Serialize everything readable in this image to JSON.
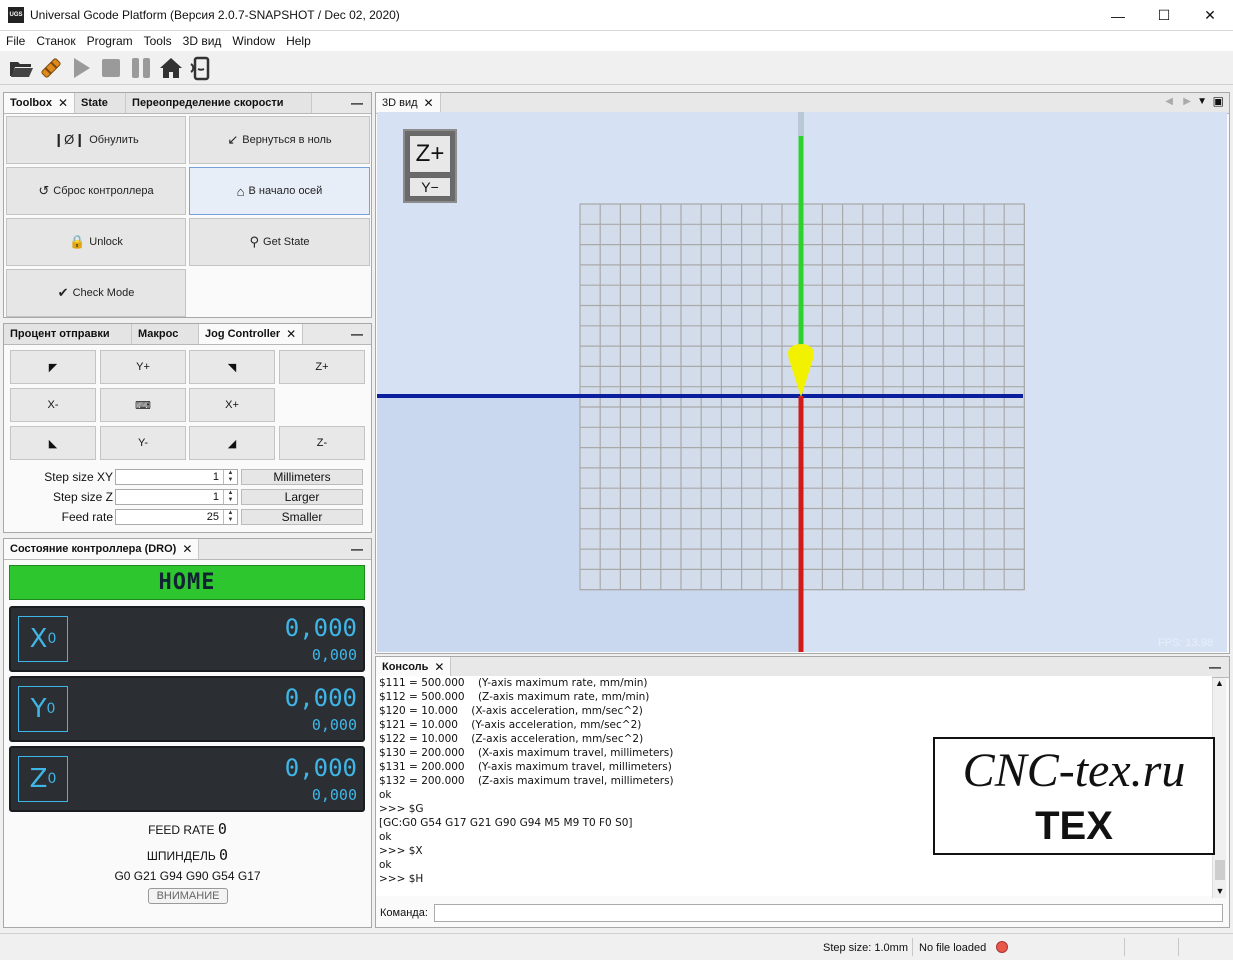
{
  "window": {
    "title": "Universal Gcode Platform (Версия 2.0.7-SNAPSHOT / Dec 02, 2020)",
    "app_icon": "UGS"
  },
  "menu": [
    "File",
    "Станок",
    "Program",
    "Tools",
    "3D вид",
    "Window",
    "Help"
  ],
  "toolbox_panel": {
    "tabs": [
      "Toolbox",
      "State",
      "Переопределение скорости"
    ],
    "buttons": [
      "Обнулить",
      "Вернуться в ноль",
      "Сброс контроллера",
      "В начало осей",
      "Unlock",
      "Get State",
      "Check Mode"
    ]
  },
  "jog_panel": {
    "tabs": [
      "Процент отправки",
      "Макрос",
      "Jog Controller"
    ],
    "buttons": {
      "yplus": "Y+",
      "zplus": "Z+",
      "xminus": "X-",
      "xplus": "X+",
      "yminus": "Y-",
      "zminus": "Z-"
    },
    "step_xy_label": "Step size XY",
    "step_xy_value": "1",
    "step_z_label": "Step size Z",
    "step_z_value": "1",
    "feed_label": "Feed rate",
    "feed_value": "25",
    "units": "Millimeters",
    "larger": "Larger",
    "smaller": "Smaller"
  },
  "dro_panel": {
    "tab": "Состояние контроллера (DRO)",
    "state": "HOME",
    "axes": [
      {
        "name": "X",
        "sub": "0",
        "work": "0,000",
        "machine": "0,000"
      },
      {
        "name": "Y",
        "sub": "0",
        "work": "0,000",
        "machine": "0,000"
      },
      {
        "name": "Z",
        "sub": "0",
        "work": "0,000",
        "machine": "0,000"
      }
    ],
    "feed_rate_label": "FEED RATE",
    "feed_rate_value": "0",
    "spindle_label": "ШПИНДЕЛЬ",
    "spindle_value": "0",
    "gcode_state": "G0 G21 G94 G90 G54 G17",
    "alarm": "ВНИМАНИЕ"
  },
  "view_panel": {
    "tab": "3D вид",
    "nav_top": "Z+",
    "nav_bottom": "Y−",
    "fps": "FPS: 13.98",
    "colors": {
      "z_axis": "#2fd12f",
      "y_axis": "#0b1e9e",
      "x_axis": "#d11a1a",
      "tool": "#f2f200"
    }
  },
  "console_panel": {
    "tab": "Консоль",
    "lines": [
      "$111 = 500.000    (Y-axis maximum rate, mm/min)",
      "$112 = 500.000    (Z-axis maximum rate, mm/min)",
      "$120 = 10.000    (X-axis acceleration, mm/sec^2)",
      "$121 = 10.000    (Y-axis acceleration, mm/sec^2)",
      "$122 = 10.000    (Z-axis acceleration, mm/sec^2)",
      "$130 = 200.000    (X-axis maximum travel, millimeters)",
      "$131 = 200.000    (Y-axis maximum travel, millimeters)",
      "$132 = 200.000    (Z-axis maximum travel, millimeters)",
      "ok",
      ">>> $G",
      "[GC:G0 G54 G17 G21 G90 G94 M5 M9 T0 F0 S0]",
      "ok",
      ">>> $X",
      "ok",
      ">>> $H"
    ],
    "command_label": "Команда:",
    "command_value": ""
  },
  "watermark": {
    "line1": "CNC-tex.ru",
    "line2": "TEX"
  },
  "status": {
    "step_size": "Step size: 1.0mm",
    "file": "No file loaded"
  }
}
